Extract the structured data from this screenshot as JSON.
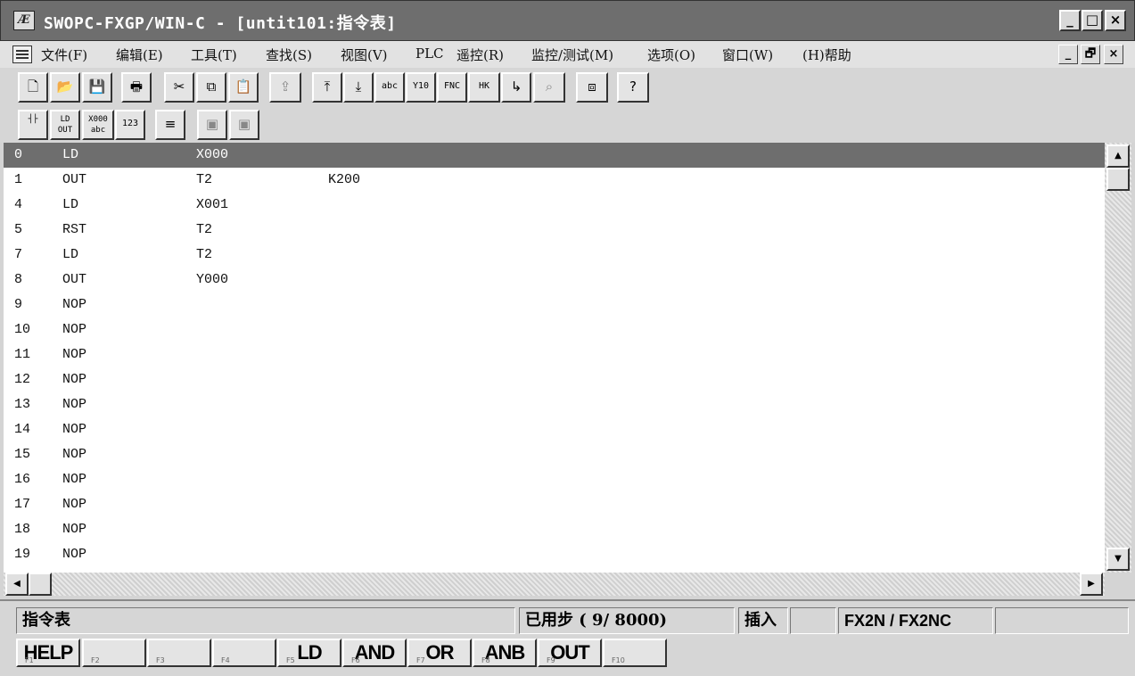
{
  "window": {
    "title": "SWOPC-FXGP/WIN-C - [untit101:指令表]",
    "app_icon_text": "Æ",
    "btn_minimize": "_",
    "btn_maximize": "□",
    "btn_close": "×"
  },
  "menu": {
    "items": [
      "文件(F)",
      "编辑(E)",
      "工具(T)",
      "查找(S)",
      "视图(V)",
      "PLC",
      "遥控(R)",
      "监控/测试(M)",
      "选项(O)",
      "窗口(W)",
      "(H)帮助"
    ],
    "mdi_minimize": "_",
    "mdi_restore": "🗗",
    "mdi_close": "×"
  },
  "toolbar1": {
    "buttons": [
      {
        "name": "new",
        "glyph": "🗋"
      },
      {
        "name": "open",
        "glyph": "📂"
      },
      {
        "name": "save",
        "glyph": "💾"
      },
      {
        "name": "print",
        "glyph": "🖶"
      },
      {
        "name": "cut",
        "glyph": "✂"
      },
      {
        "name": "copy",
        "glyph": "⧉"
      },
      {
        "name": "paste",
        "glyph": "📋"
      },
      {
        "name": "transfer",
        "glyph": "⇪"
      },
      {
        "name": "page-up",
        "glyph": "⤒"
      },
      {
        "name": "page-down",
        "glyph": "⤓"
      },
      {
        "name": "abc",
        "glyph": "abc"
      },
      {
        "name": "y10",
        "glyph": "Y10"
      },
      {
        "name": "fnc",
        "glyph": "FNC"
      },
      {
        "name": "hk",
        "glyph": "HK"
      },
      {
        "name": "jump",
        "glyph": "↳"
      },
      {
        "name": "binoculars",
        "glyph": "⌕"
      },
      {
        "name": "window-switch",
        "glyph": "⧈"
      },
      {
        "name": "help",
        "glyph": "?"
      }
    ]
  },
  "toolbar2": {
    "buttons": [
      {
        "name": "ladder-view",
        "glyph": "┤├"
      },
      {
        "name": "list-view",
        "glyph": "LD OUT"
      },
      {
        "name": "comment",
        "glyph": "X000 abc"
      },
      {
        "name": "number",
        "glyph": "123"
      },
      {
        "name": "sfc",
        "glyph": "≡"
      },
      {
        "name": "disabled-1",
        "glyph": "▣"
      },
      {
        "name": "disabled-2",
        "glyph": "▣"
      }
    ]
  },
  "instructions": [
    {
      "step": "0",
      "inst": "LD",
      "op1": "X000",
      "op2": ""
    },
    {
      "step": "1",
      "inst": "OUT",
      "op1": "T2",
      "op2": "K200"
    },
    {
      "step": "4",
      "inst": "LD",
      "op1": "X001",
      "op2": ""
    },
    {
      "step": "5",
      "inst": "RST",
      "op1": "T2",
      "op2": ""
    },
    {
      "step": "7",
      "inst": "LD",
      "op1": "T2",
      "op2": ""
    },
    {
      "step": "8",
      "inst": "OUT",
      "op1": "Y000",
      "op2": ""
    },
    {
      "step": "9",
      "inst": "NOP",
      "op1": "",
      "op2": ""
    },
    {
      "step": "10",
      "inst": "NOP",
      "op1": "",
      "op2": ""
    },
    {
      "step": "11",
      "inst": "NOP",
      "op1": "",
      "op2": ""
    },
    {
      "step": "12",
      "inst": "NOP",
      "op1": "",
      "op2": ""
    },
    {
      "step": "13",
      "inst": "NOP",
      "op1": "",
      "op2": ""
    },
    {
      "step": "14",
      "inst": "NOP",
      "op1": "",
      "op2": ""
    },
    {
      "step": "15",
      "inst": "NOP",
      "op1": "",
      "op2": ""
    },
    {
      "step": "16",
      "inst": "NOP",
      "op1": "",
      "op2": ""
    },
    {
      "step": "17",
      "inst": "NOP",
      "op1": "",
      "op2": ""
    },
    {
      "step": "18",
      "inst": "NOP",
      "op1": "",
      "op2": ""
    },
    {
      "step": "19",
      "inst": "NOP",
      "op1": "",
      "op2": ""
    }
  ],
  "scroll": {
    "up": "▲",
    "down": "▼",
    "left": "◀",
    "right": "▶"
  },
  "status": {
    "mode": "指令表",
    "steps_label": "已用步 (   9/ 8000)",
    "insert": "插入",
    "plc_model": "FX2N / FX2NC"
  },
  "fkeys": [
    {
      "num": "F1",
      "label": "HELP"
    },
    {
      "num": "F2",
      "label": ""
    },
    {
      "num": "F3",
      "label": ""
    },
    {
      "num": "F4",
      "label": ""
    },
    {
      "num": "F5",
      "label": "LD"
    },
    {
      "num": "F6",
      "label": "AND"
    },
    {
      "num": "F7",
      "label": "OR"
    },
    {
      "num": "F8",
      "label": "ANB"
    },
    {
      "num": "F9",
      "label": "OUT"
    },
    {
      "num": "F10",
      "label": ""
    }
  ]
}
